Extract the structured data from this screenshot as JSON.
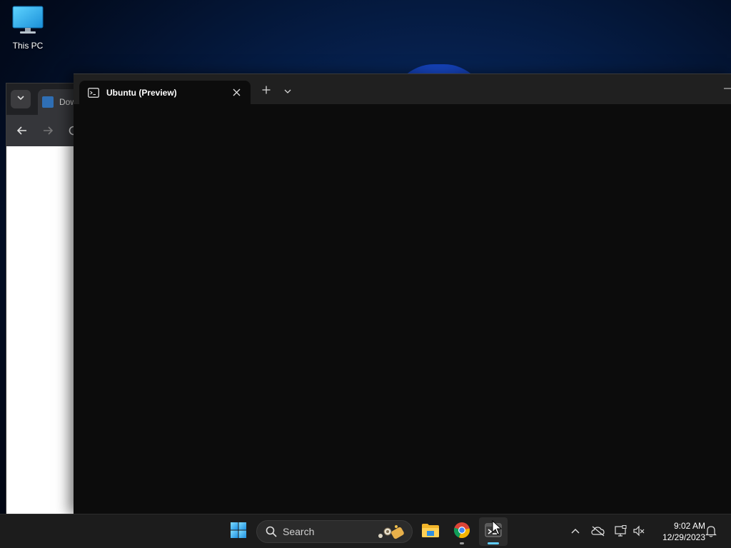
{
  "desktop": {
    "icons": [
      {
        "label": "This PC",
        "icon": "monitor-icon"
      }
    ]
  },
  "chrome_window": {
    "tab_label": "Dow",
    "icons": [
      "tab-search-icon",
      "back-arrow-icon",
      "forward-arrow-icon",
      "reload-icon"
    ]
  },
  "terminal_window": {
    "tab": {
      "label": "Ubuntu (Preview)",
      "icon": "terminal-icon"
    },
    "new_tab_icon": "plus-icon",
    "dropdown_icon": "chevron-down-icon",
    "background_color": "#0c0c0c"
  },
  "taskbar": {
    "search_placeholder": "Search",
    "apps": [
      {
        "name": "start",
        "icon": "windows-logo-icon"
      },
      {
        "name": "file-explorer",
        "icon": "folder-icon"
      },
      {
        "name": "chrome",
        "icon": "chrome-icon"
      },
      {
        "name": "terminal",
        "icon": "terminal-icon",
        "active": true
      }
    ],
    "tray": {
      "icons": [
        "chevron-up-icon",
        "onedrive-offline-icon",
        "network-icon",
        "volume-muted-icon",
        "notification-bell-icon"
      ]
    },
    "clock": {
      "time": "9:02 AM",
      "date": "12/29/2023"
    },
    "accent_color": "#60cdff"
  }
}
